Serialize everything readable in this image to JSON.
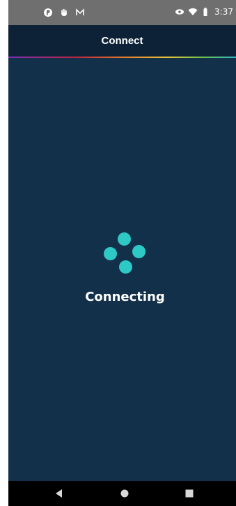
{
  "status_bar": {
    "time": "3:37",
    "left_icons": [
      "app-notification-icon",
      "hand-icon",
      "mail-icon"
    ],
    "right_icons": [
      "eye-icon",
      "wifi-icon",
      "battery-icon"
    ]
  },
  "app_bar": {
    "title": "Connect"
  },
  "main": {
    "status_text": "Connecting"
  },
  "nav_bar": {
    "buttons": [
      "back-button",
      "home-button",
      "recents-button"
    ]
  },
  "colors": {
    "background": "#13304a",
    "app_bar": "#0d2236",
    "accent": "#2ec9c5"
  }
}
